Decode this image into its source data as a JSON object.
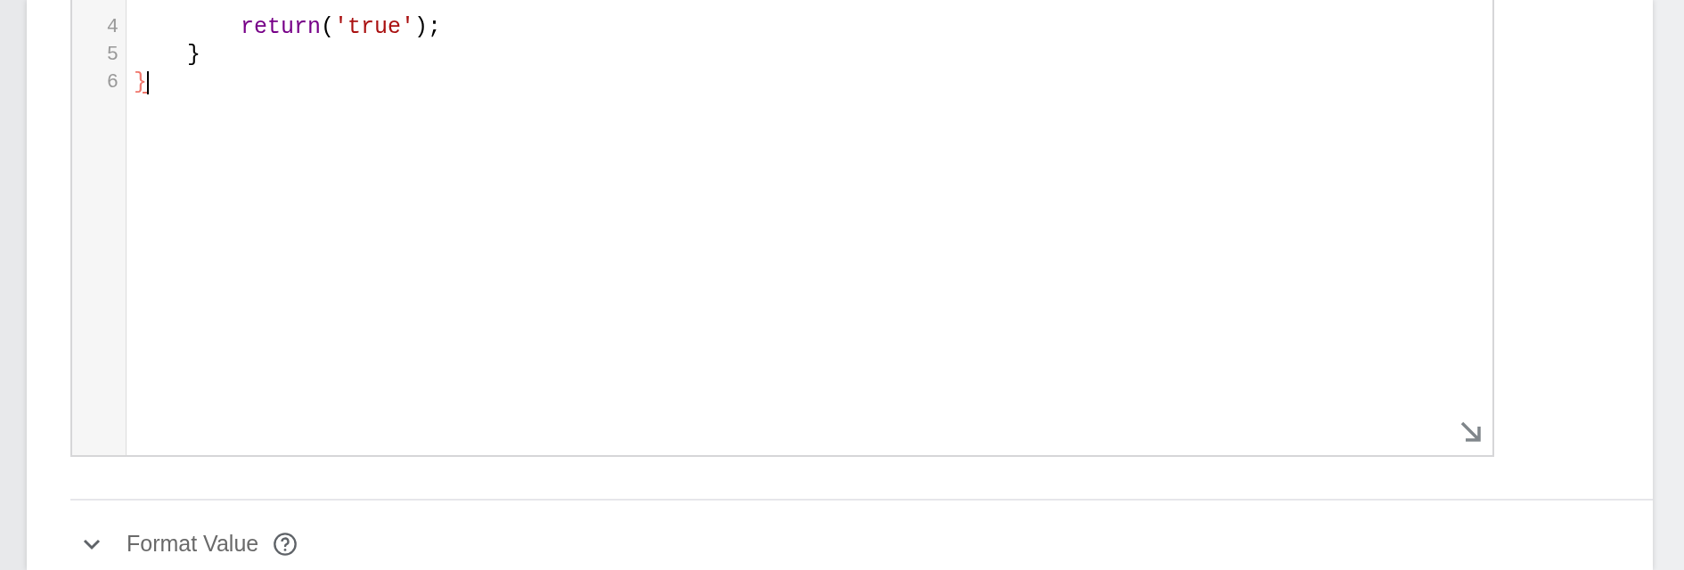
{
  "editor": {
    "lines": [
      {
        "number": "4",
        "cursor": false,
        "tokens": [
          {
            "kind": "keyword",
            "text": "        return"
          },
          {
            "kind": "plain",
            "text": "("
          },
          {
            "kind": "string",
            "text": "'true'"
          },
          {
            "kind": "plain",
            "text": ");"
          }
        ]
      },
      {
        "number": "5",
        "cursor": false,
        "tokens": [
          {
            "kind": "plain",
            "text": "    }"
          }
        ]
      },
      {
        "number": "6",
        "cursor": true,
        "tokens": [
          {
            "kind": "unmatched",
            "text": "}"
          }
        ]
      }
    ]
  },
  "section": {
    "title": "Format Value",
    "expanded": false
  }
}
